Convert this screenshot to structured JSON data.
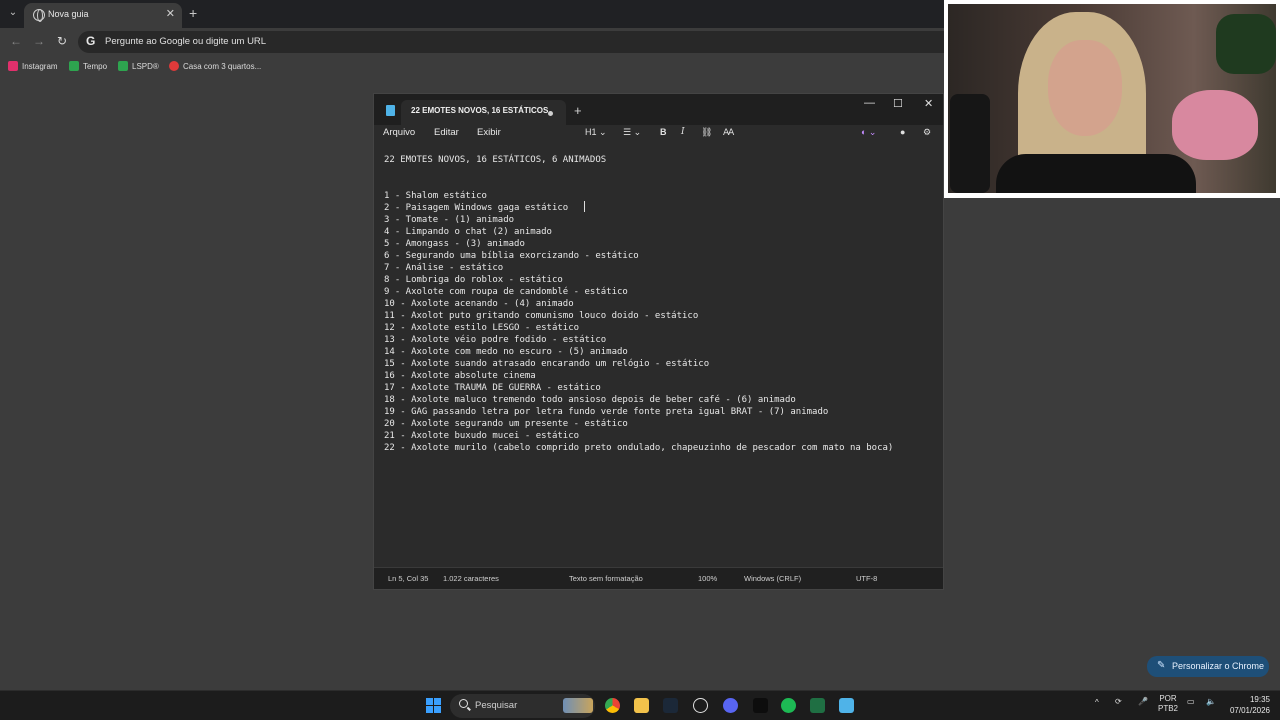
{
  "browser": {
    "tab_title": "Nova guia",
    "omnibox_placeholder": "Pergunte ao Google ou digite um URL",
    "bookmarks": [
      {
        "label": "Instagram",
        "color": "#e1306c"
      },
      {
        "label": "Tempo",
        "color": "#2ea44f"
      },
      {
        "label": "LSPD®",
        "color": "#2ea44f"
      },
      {
        "label": "Casa com 3 quartos...",
        "color": "#e03a3a"
      }
    ],
    "personalize_label": "Personalizar o Chrome"
  },
  "notepad": {
    "tab_title": "22 EMOTES NOVOS, 16 ESTÁTICOS,",
    "menu": {
      "file": "Arquivo",
      "edit": "Editar",
      "view": "Exibir"
    },
    "format": {
      "heading": "H1",
      "bold": "B",
      "italic": "I"
    },
    "lines": [
      "22 EMOTES NOVOS, 16 ESTÁTICOS, 6 ANIMADOS",
      "",
      "1 - Shalom estático",
      "2 - Paisagem Windows gaga estático",
      "3 - Tomate - (1) animado",
      "4 - Limpando o chat (2) animado",
      "5 - Amongass - (3) animado",
      "6 - Segurando uma bíblia exorcizando - estático",
      "7 - Análise - estático",
      "8 - Lombriga do roblox - estático",
      "9 - Axolote com roupa de candomblé - estático",
      "10 - Axolote acenando - (4) animado",
      "11 - Axolot puto gritando comunismo louco doido - estático",
      "12 - Axolote estilo LESGO - estático",
      "13 - Axolote véio podre fodido - estático",
      "14 - Axolote com medo no escuro - (5) animado",
      "15 - Axolote suando atrasado encarando um relógio - estático",
      "16 - Axolote absolute cinema",
      "17 - Axolote TRAUMA DE GUERRA - estático",
      "18 - Axolote maluco tremendo todo ansioso depois de beber café - (6) animado",
      "19 - GAG passando letra por letra fundo verde fonte preta igual BRAT - (7) animado",
      "20 - Axolote segurando um presente - estático",
      "21 - Axolote buxudo mucei - estático",
      "22 - Axolote murilo (cabelo comprido preto ondulado, chapeuzinho de pescador com mato na boca)"
    ],
    "status": {
      "position": "Ln 5, Col 35",
      "chars": "1.022 caracteres",
      "format": "Texto sem formatação",
      "zoom": "100%",
      "eol": "Windows (CRLF)",
      "encoding": "UTF-8"
    }
  },
  "taskbar": {
    "search_label": "Pesquisar",
    "lang_top": "POR",
    "lang_bottom": "PTB2",
    "time": "19:35",
    "date": "07/01/2026"
  }
}
